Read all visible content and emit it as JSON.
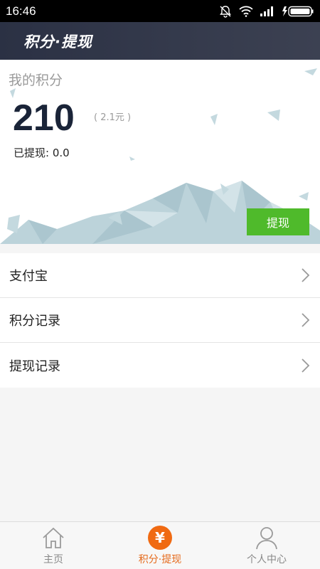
{
  "status_bar": {
    "time": "16:46"
  },
  "header": {
    "title": "积分·提现"
  },
  "points_card": {
    "label": "我的积分",
    "points": "210",
    "cash_equivalent": "( 2.1元 )",
    "withdrawn": "已提现: 0.0",
    "withdraw_button": "提现"
  },
  "menu": {
    "items": [
      {
        "label": "支付宝"
      },
      {
        "label": "积分记录"
      },
      {
        "label": "提现记录"
      }
    ]
  },
  "tabs": [
    {
      "label": "主页",
      "icon": "home-icon",
      "active": false
    },
    {
      "label": "积分·提现",
      "icon": "yen-icon",
      "active": true
    },
    {
      "label": "个人中心",
      "icon": "user-icon",
      "active": false
    }
  ],
  "colors": {
    "accent": "#f06a12",
    "button_green": "#4fba2b",
    "header_bg": "#2b3144"
  }
}
